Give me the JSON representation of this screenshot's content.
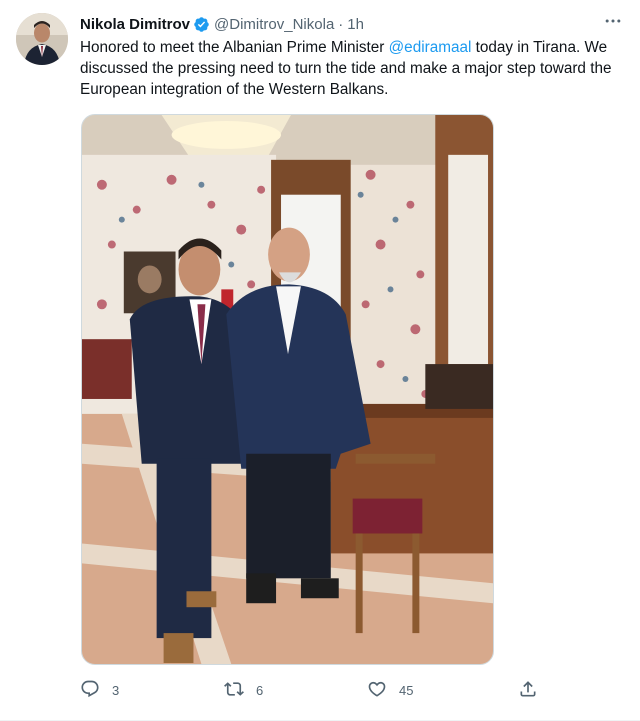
{
  "tweet": {
    "author_name": "Nikola Dimitrov",
    "handle": "@Dimitrov_Nikola",
    "separator": "·",
    "time": "1h",
    "text_before": "Honored to meet the Albanian Prime Minister ",
    "mention": "@ediramaal",
    "text_after": " today in Tirana. We discussed the pressing need to turn the tide and make a major step toward the European integration of the Western Balkans.",
    "verified_icon": "verified-badge-icon",
    "more_icon": "more-options-icon"
  },
  "actions": {
    "reply_count": "3",
    "retweet_count": "6",
    "like_count": "45",
    "reply_icon": "reply-icon",
    "retweet_icon": "retweet-icon",
    "like_icon": "heart-icon",
    "share_icon": "share-icon"
  },
  "colors": {
    "text": "#0f1419",
    "secondary": "#536471",
    "accent": "#1d9bf0",
    "border": "#cfd9de"
  }
}
